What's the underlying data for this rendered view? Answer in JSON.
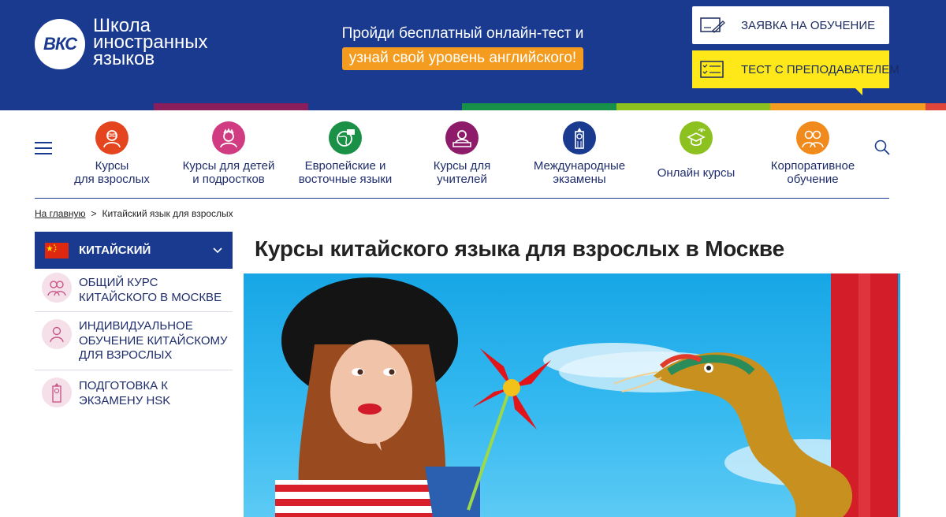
{
  "header": {
    "logo_mark": "ВКС",
    "logo_lines": [
      "Школа",
      "иностранных",
      "языков"
    ],
    "promo_line1": "Пройди бесплатный онлайн-тест и",
    "promo_line2": "узнай свой уровень английского!",
    "apply_button": "ЗАЯВКА НА ОБУЧЕНИЕ",
    "test_button": "ТЕСТ С ПРЕПОДАВАТЕЛЕМ"
  },
  "stripe_colors": [
    "#1a3a8f",
    "#8a1d5c",
    "#1a3a8f",
    "#17904a",
    "#8cc11f",
    "#f39c1f",
    "#e0453a"
  ],
  "nav": {
    "menu_icon": "hamburger-icon",
    "search_icon": "search-icon",
    "items": [
      {
        "label_1": "Курсы",
        "label_2": "для взрослых",
        "color": "#e4451e",
        "icon": "adult-icon"
      },
      {
        "label_1": "Курсы для детей",
        "label_2": "и подростков",
        "color": "#d03b82",
        "icon": "kid-icon"
      },
      {
        "label_1": "Европейские и",
        "label_2": "восточные языки",
        "color": "#1a9147",
        "icon": "globe-icon"
      },
      {
        "label_1": "Курсы для",
        "label_2": "учителей",
        "color": "#8e1b6a",
        "icon": "teacher-icon"
      },
      {
        "label_1": "Международные",
        "label_2": "экзамены",
        "color": "#1a3a8f",
        "icon": "big-ben-icon"
      },
      {
        "label_1": "Онлайн курсы",
        "label_2": "",
        "color": "#8cc11f",
        "icon": "online-icon"
      },
      {
        "label_1": "Корпоративное",
        "label_2": "обучение",
        "color": "#f08a1c",
        "icon": "group-icon"
      }
    ]
  },
  "breadcrumb": {
    "home": "На главную",
    "separator": ">",
    "current": "Китайский язык для взрослых"
  },
  "sidebar": {
    "heading": "КИТАЙСКИЙ",
    "items": [
      {
        "label": "ОБЩИЙ КУРС КИТАЙСКОГО В МОСКВЕ",
        "icon": "people-icon"
      },
      {
        "label": "ИНДИВИДУАЛЬНОЕ ОБУЧЕНИЕ КИТАЙСКОМУ ДЛЯ ВЗРОСЛЫХ",
        "icon": "person-icon"
      },
      {
        "label": "ПОДГОТОВКА К ЭКЗАМЕНУ HSK",
        "icon": "big-ben-icon"
      }
    ]
  },
  "main": {
    "title": "Курсы китайского языка для взрослых в Москве",
    "hero_icon": "hero-image"
  }
}
